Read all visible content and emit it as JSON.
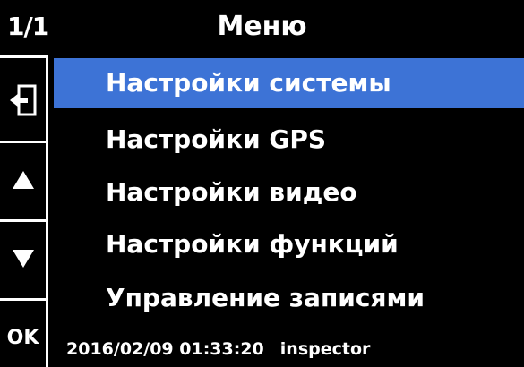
{
  "header": {
    "page_indicator": "1/1",
    "title": "Меню"
  },
  "sidebar": {
    "back_icon": "exit-door-arrow-icon",
    "up_icon": "triangle-up-icon",
    "down_icon": "triangle-down-icon",
    "ok_label": "OK"
  },
  "menu": {
    "items": [
      {
        "label": "Настройки системы",
        "selected": true
      },
      {
        "label": "Настройки GPS",
        "selected": false
      },
      {
        "label": "Настройки видео",
        "selected": false
      },
      {
        "label": "Настройки функций",
        "selected": false
      },
      {
        "label": "Управление записями",
        "selected": false
      }
    ]
  },
  "footer": {
    "datetime": "2016/02/09 01:33:20",
    "user": "inspector"
  },
  "colors": {
    "background": "#000000",
    "text": "#ffffff",
    "selection": "#3d73d6"
  }
}
